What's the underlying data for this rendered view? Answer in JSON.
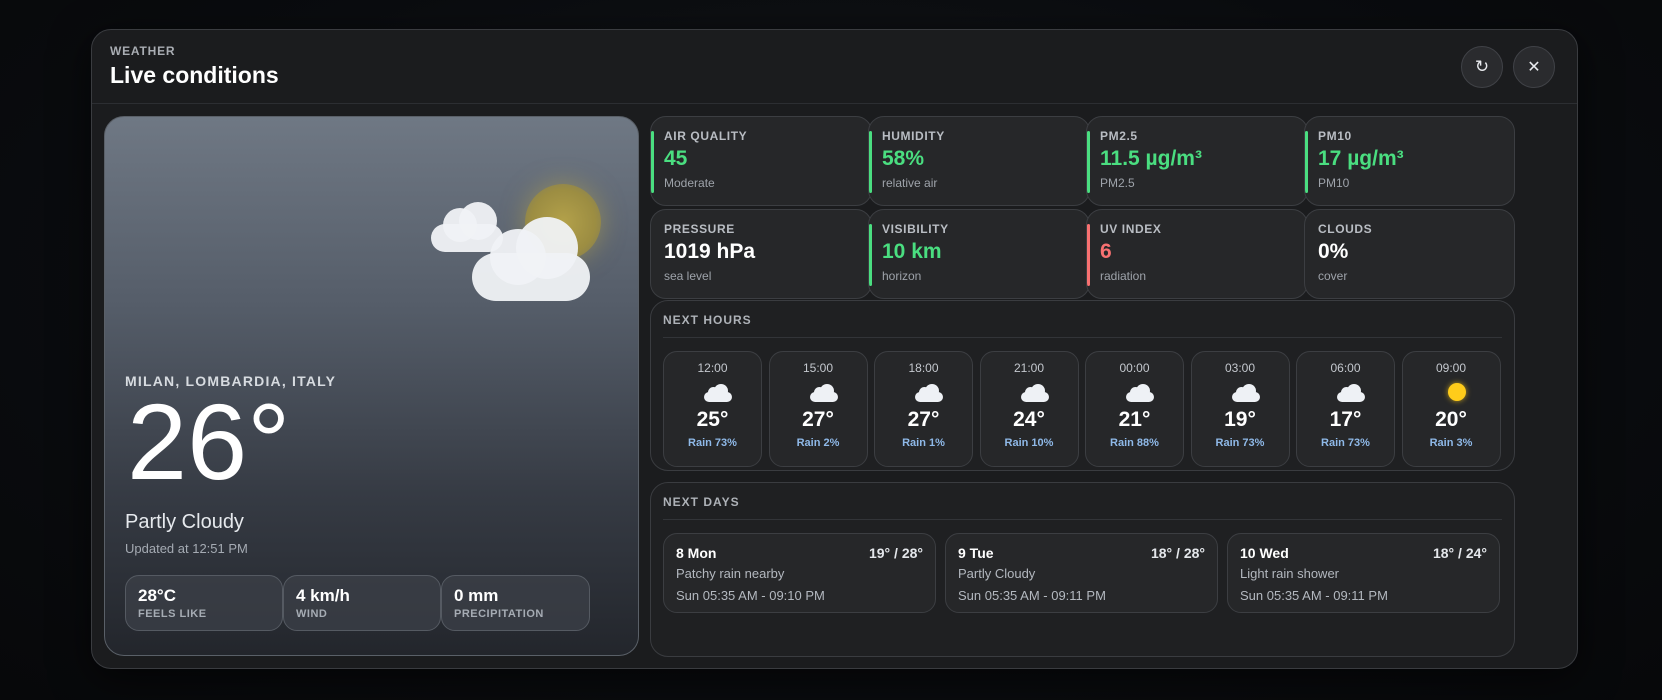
{
  "header": {
    "eyebrow": "WEATHER",
    "title": "Live conditions",
    "refresh_icon": "↻",
    "close_icon": "✕"
  },
  "current": {
    "location": "MILAN, LOMBARDIA, ITALY",
    "temperature": "26°",
    "condition": "Partly Cloudy",
    "updated": "Updated at 12:51 PM",
    "icon": "partly-cloudy-icon",
    "stats": [
      {
        "value": "28°C",
        "label": "FEELS LIKE"
      },
      {
        "value": "4 km/h",
        "label": "WIND"
      },
      {
        "value": "0 mm",
        "label": "PRECIPITATION"
      }
    ]
  },
  "metrics": [
    {
      "label": "AIR QUALITY",
      "value": "45",
      "sub": "Moderate",
      "color": "#4ade80",
      "accent": "#4ade80"
    },
    {
      "label": "HUMIDITY",
      "value": "58%",
      "sub": "relative air",
      "color": "#4ade80",
      "accent": "#4ade80"
    },
    {
      "label": "PM2.5",
      "value": "11.5 µg/m³",
      "sub": "PM2.5",
      "color": "#4ade80",
      "accent": "#4ade80"
    },
    {
      "label": "PM10",
      "value": "17 µg/m³",
      "sub": "PM10",
      "color": "#4ade80",
      "accent": "#4ade80"
    },
    {
      "label": "PRESSURE",
      "value": "1019 hPa",
      "sub": "sea level",
      "color": "#ffffff",
      "accent": ""
    },
    {
      "label": "VISIBILITY",
      "value": "10 km",
      "sub": "horizon",
      "color": "#4ade80",
      "accent": "#4ade80"
    },
    {
      "label": "UV INDEX",
      "value": "6",
      "sub": "radiation",
      "color": "#f87171",
      "accent": "#f87171"
    },
    {
      "label": "CLOUDS",
      "value": "0%",
      "sub": "cover",
      "color": "#ffffff",
      "accent": ""
    }
  ],
  "hourly": {
    "title": "NEXT HOURS",
    "items": [
      {
        "time": "12:00",
        "temp": "25°",
        "rain": "Rain 73%",
        "icon": "cloud-icon"
      },
      {
        "time": "15:00",
        "temp": "27°",
        "rain": "Rain 2%",
        "icon": "cloud-icon"
      },
      {
        "time": "18:00",
        "temp": "27°",
        "rain": "Rain 1%",
        "icon": "cloud-icon"
      },
      {
        "time": "21:00",
        "temp": "24°",
        "rain": "Rain 10%",
        "icon": "cloud-icon"
      },
      {
        "time": "00:00",
        "temp": "21°",
        "rain": "Rain 88%",
        "icon": "cloud-icon"
      },
      {
        "time": "03:00",
        "temp": "19°",
        "rain": "Rain 73%",
        "icon": "cloud-icon"
      },
      {
        "time": "06:00",
        "temp": "17°",
        "rain": "Rain 73%",
        "icon": "cloud-icon"
      },
      {
        "time": "09:00",
        "temp": "20°",
        "rain": "Rain 3%",
        "icon": "sun-icon"
      }
    ]
  },
  "daily": {
    "title": "NEXT DAYS",
    "items": [
      {
        "day": "8 Mon",
        "range": "19° / 28°",
        "desc": "Patchy rain nearby",
        "sun": "Sun 05:35 AM - 09:10 PM"
      },
      {
        "day": "9 Tue",
        "range": "18° / 28°",
        "desc": "Partly Cloudy",
        "sun": "Sun 05:35 AM - 09:11 PM"
      },
      {
        "day": "10 Wed",
        "range": "18° / 24°",
        "desc": "Light rain shower",
        "sun": "Sun 05:35 AM - 09:11 PM"
      }
    ]
  }
}
